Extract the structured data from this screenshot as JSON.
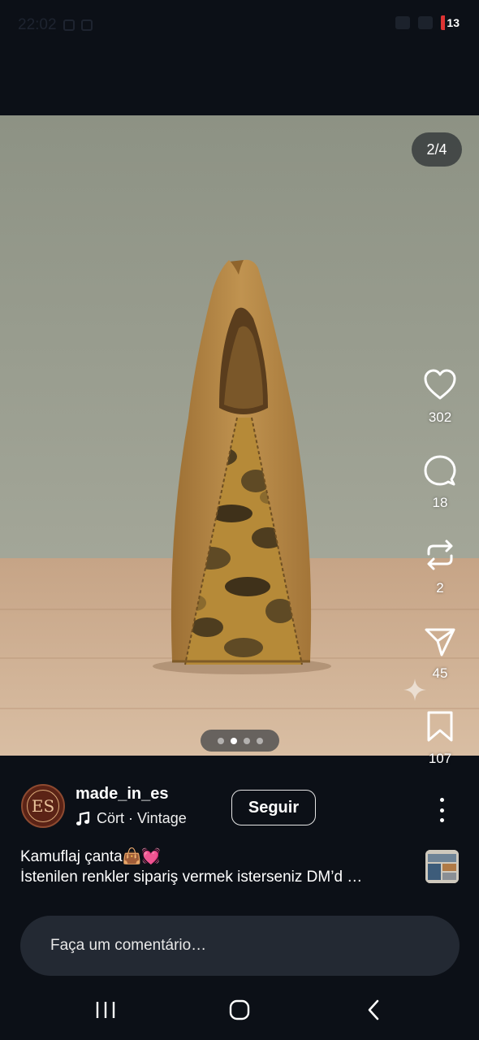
{
  "status_bar": {
    "time": "22:02",
    "battery_level": "13",
    "battery_color": "#dd3333"
  },
  "post": {
    "image_counter": "2/4",
    "image_count": 4,
    "current_image": 2,
    "likes": "302",
    "comments": "18",
    "reposts": "2",
    "shares": "45",
    "saves": "107"
  },
  "author": {
    "username": "made_in_es",
    "avatar_initials": "ES",
    "music_icon": "music-note-icon",
    "music_label": "Cört · Vintage",
    "follow_label": "Seguir"
  },
  "caption": {
    "line1": "Kamuflaj çanta👜💓",
    "line2": "İstenilen renkler sipariş vermek isterseniz DM’d …"
  },
  "comment_box": {
    "placeholder": "Faça um comentário…"
  },
  "icons": {
    "like": "heart-icon",
    "comment": "comment-bubble-icon",
    "repost": "repost-icon",
    "share": "send-icon",
    "save": "bookmark-icon",
    "more": "more-vertical-icon"
  },
  "colors": {
    "background": "#0c1017",
    "comment_box": "#232933",
    "bag_suede": "#b58744"
  }
}
